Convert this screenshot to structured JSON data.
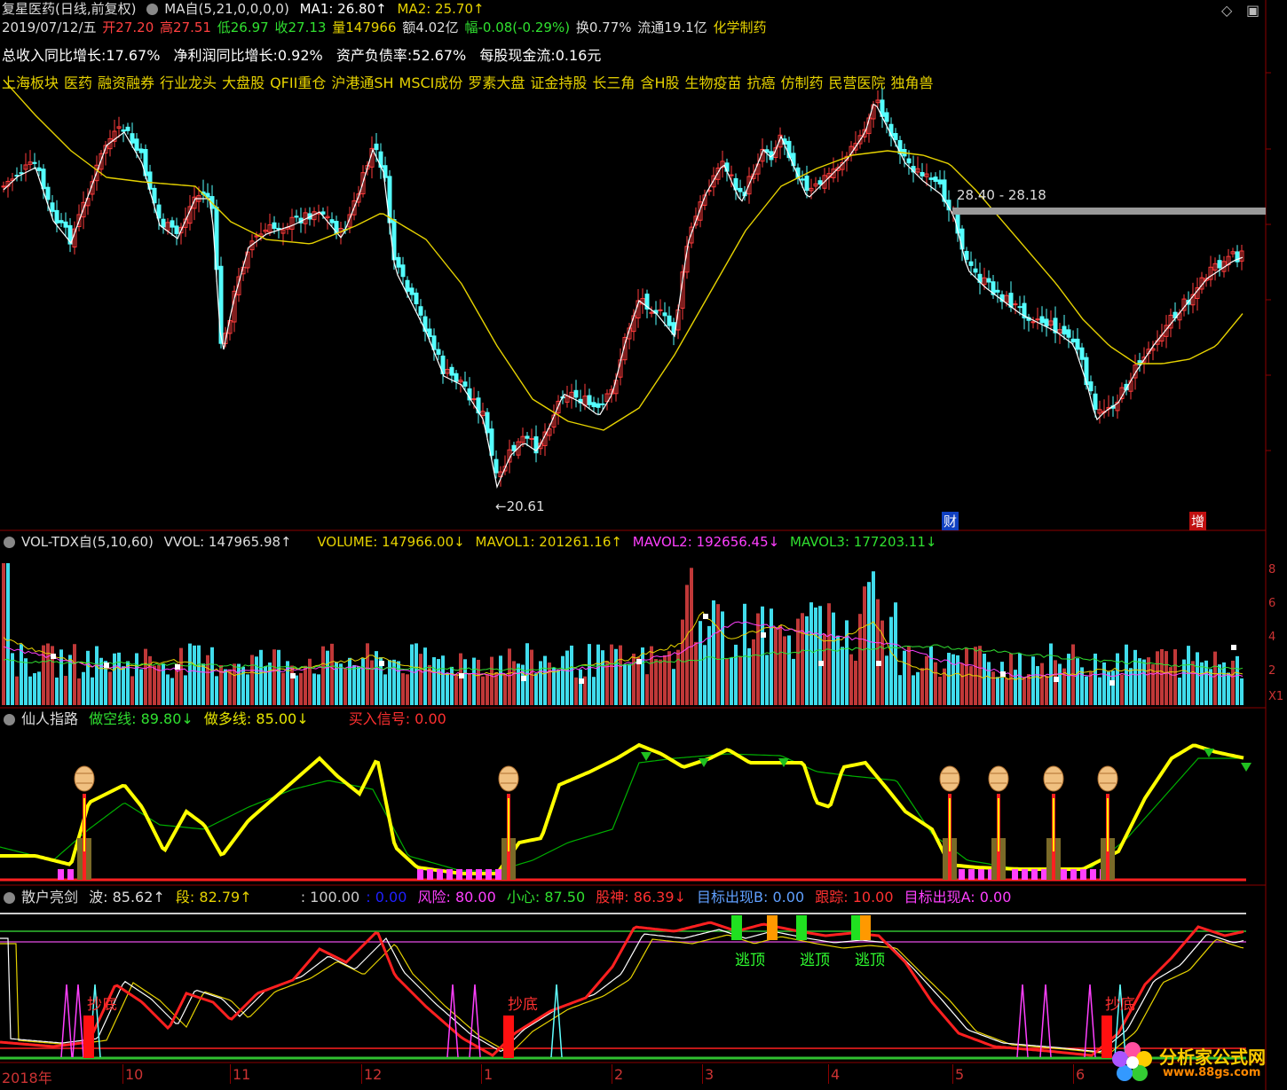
{
  "header": {
    "stock_name": "复星医药(日线,前复权)",
    "ma_label": "MA自(5,21,0,0,0,0)",
    "ma1": "MA1: 26.80↑",
    "ma2": "MA2: 25.70↑",
    "window_icon1": "◇",
    "window_icon2": "▣"
  },
  "quote": {
    "date": "2019/07/12/五",
    "open": "开27.20",
    "high": "高27.51",
    "low": "低26.97",
    "close": "收27.13",
    "volume": "量147966",
    "amount": "额4.02亿",
    "change": "幅-0.08(-0.29%)",
    "turnover": "换0.77%",
    "float": "流通19.1亿",
    "industry": "化学制药"
  },
  "finance": {
    "revenue_growth": "总收入同比增长:17.67%",
    "profit_growth": "净利润同比增长:0.92%",
    "debt_ratio": "资产负债率:52.67%",
    "cash_flow": "每股现金流:0.16元"
  },
  "concepts": [
    "上海板块",
    "医药",
    "融资融券",
    "行业龙头",
    "大盘股",
    "QFII重仓",
    "沪港通SH",
    "MSCI成份",
    "罗素大盘",
    "证金持股",
    "长三角",
    "含H股",
    "生物疫苗",
    "抗癌",
    "仿制药",
    "民营医院",
    "独角兽"
  ],
  "price_annotations": {
    "low_label": "←20.61",
    "range_label": "28.40 - 28.18",
    "cai_marker": "财",
    "zeng_marker": "增"
  },
  "volume_panel": {
    "title": "VOL-TDX自(5,10,60)",
    "vvol": "VVOL: 147965.98↑",
    "volume": "VOLUME: 147966.00↓",
    "mavol1": "MAVOL1: 201261.16↑",
    "mavol2": "MAVOL2: 192656.45↓",
    "mavol3": "MAVOL3: 177203.11↓",
    "scale": [
      "8",
      "6",
      "4",
      "2",
      "X1"
    ]
  },
  "xianren_panel": {
    "title": "仙人指路",
    "short_line": "做空线: 89.80↓",
    "long_line": "做多线: 85.00↓",
    "buy_signal": "买入信号: 0.00"
  },
  "sanhu_panel": {
    "title": "散户亮剑",
    "wave": "波: 85.62↑",
    "segment": "段: 82.79↑",
    "v100": ": 100.00",
    "v0": ": 0.00",
    "risk": "风险: 80.00",
    "careful": "小心: 87.50",
    "stock_god": "股神: 86.39↓",
    "target_b": "目标出现B: 0.00",
    "track": "跟踪: 10.00",
    "target_a": "目标出现A: 0.00",
    "escape_label": "逃顶",
    "bottom_label": "抄底"
  },
  "x_axis": {
    "labels": [
      "2018年",
      "10",
      "11",
      "12",
      "1",
      "2",
      "3",
      "4",
      "5",
      "6"
    ]
  },
  "watermark": {
    "site": "分析家公式网",
    "url": "www.88gs.com"
  },
  "colors": {
    "up": "#ff3b3b",
    "down": "#54ffff",
    "ma1": "#ffffff",
    "ma2": "#e6d200",
    "yellow_line": "#ffff00",
    "green_line": "#00c000",
    "magenta": "#ff00ff"
  }
}
